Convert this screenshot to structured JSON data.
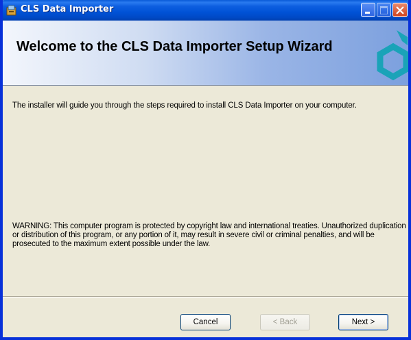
{
  "window": {
    "title": "CLS Data Importer"
  },
  "banner": {
    "title": "Welcome to the CLS Data Importer Setup Wizard"
  },
  "content": {
    "intro": "The installer will guide you through the steps required to install CLS Data Importer on your computer.",
    "warning": "WARNING: This computer program is protected by copyright law and international treaties. Unauthorized duplication or distribution of this program, or any portion of it, may result in severe civil or criminal penalties, and will be prosecuted to the maximum extent possible under the law."
  },
  "buttons": {
    "cancel": "Cancel",
    "back": "< Back",
    "next": "Next >"
  },
  "colors": {
    "titlebar": "#0052d6",
    "window_face": "#ece9d8",
    "close_button": "#d0431e"
  },
  "icons": {
    "title_icon": "installer-icon",
    "banner_logo": "hexagon-logo-icon"
  }
}
